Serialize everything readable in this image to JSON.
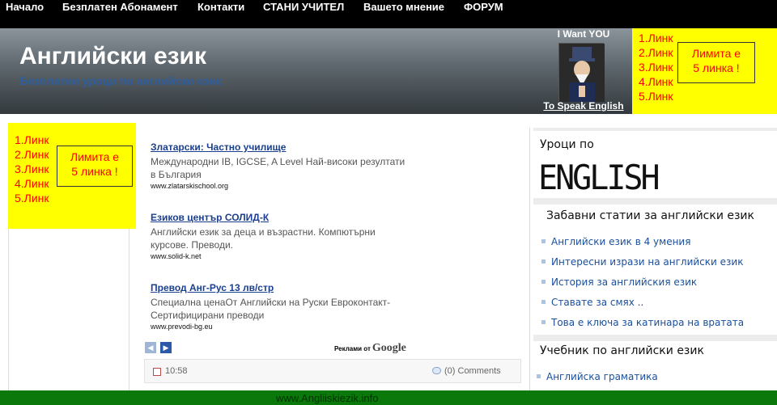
{
  "nav": {
    "items": [
      "Начало",
      "Безплатен Абонамент",
      "Контакти",
      "СТАНИ УЧИТЕЛ",
      "Вашето мнение",
      "ФОРУМ"
    ]
  },
  "header": {
    "title": "Английски език",
    "tagline": "Безплатни уроци по английски език",
    "promo_top": "I Want YOU",
    "promo_bottom": "To Speak English"
  },
  "link_ad": {
    "links": [
      "1.Линк",
      "2.Линк",
      "3.Линк",
      "4.Линк",
      "5.Линк"
    ],
    "limit_text_1": "Лимита е",
    "limit_text_2": "5 линка !"
  },
  "google_ads": [
    {
      "title": "Златарски: Частно училище",
      "text": "Международни IB, IGCSE, A Level Най-високи резултати в България",
      "url": "www.zlatarskischool.org"
    },
    {
      "title": "Езиков център СОЛИД-К",
      "text": "Английски език за деца и възрастни. Компютърни курсове. Преводи.",
      "url": "www.solid-k.net"
    },
    {
      "title": "Превод Анг-Рус 13 лв/стр",
      "text": "Специална ценаОт Английски на Руски Евроконтакт-Сертифицирани преводи",
      "url": "www.prevodi-bg.eu"
    }
  ],
  "ads_by": {
    "label": "Реклами от",
    "brand": "Google"
  },
  "post": {
    "time": "10:58",
    "comments": "(0) Comments"
  },
  "sidebar": {
    "lessons_title": "Уроци по",
    "english_image_text": "ENGLISH",
    "fun_title": "Забавни статии за английски език",
    "fun_items": [
      "Английски език в 4 умения",
      "Интересни изрази на английски език",
      "История за английския език",
      "Ставате за смях ..",
      "Това е ключа за катинара на вратата"
    ],
    "textbook_title": "Учебник по английски език",
    "textbook_items": [
      "Английска граматика"
    ]
  },
  "footer": {
    "text": "www.Angliiskiezik.info"
  },
  "colors": {
    "nav_bg": "#000000",
    "ad_yellow": "#ffff00",
    "ad_text": "#ff0000",
    "link_blue": "#1a4f9c",
    "footer_green": "#0a780a"
  }
}
